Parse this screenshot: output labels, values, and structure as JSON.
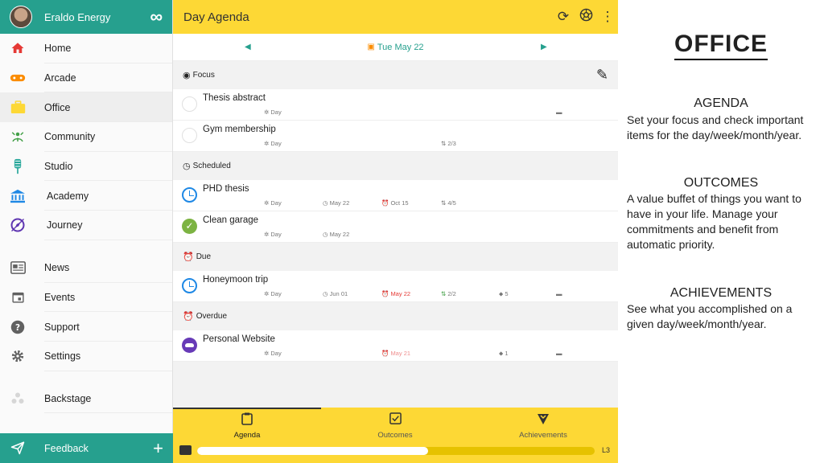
{
  "sidebar": {
    "app_title": "Eraldo Energy",
    "items": [
      {
        "label": "Home",
        "icon": "home-icon",
        "color": "#e53935"
      },
      {
        "label": "Arcade",
        "icon": "gamepad-icon",
        "color": "#fb8c00"
      },
      {
        "label": "Office",
        "icon": "briefcase-icon",
        "color": "#fdd835"
      },
      {
        "label": "Community",
        "icon": "community-icon",
        "color": "#43a047"
      },
      {
        "label": "Studio",
        "icon": "microphone-icon",
        "color": "#26a69a"
      },
      {
        "label": "Academy",
        "icon": "academy-icon",
        "color": "#1e88e5"
      },
      {
        "label": "Journey",
        "icon": "compass-icon",
        "color": "#5e35b1"
      },
      {
        "label": "News",
        "icon": "newspaper-icon",
        "color": "#616161"
      },
      {
        "label": "Events",
        "icon": "calendar-icon",
        "color": "#616161"
      },
      {
        "label": "Support",
        "icon": "help-icon",
        "color": "#616161"
      },
      {
        "label": "Settings",
        "icon": "gear-icon",
        "color": "#616161"
      },
      {
        "label": "Backstage",
        "icon": "backstage-icon",
        "color": "#bdbdbd"
      }
    ],
    "feedback_label": "Feedback"
  },
  "topbar": {
    "title": "Day Agenda"
  },
  "datebar": {
    "date": "Tue May 22"
  },
  "sections": [
    {
      "title": "Focus",
      "tasks": [
        {
          "name": "Thesis abstract",
          "status": "open",
          "meta": {
            "scope": "Day"
          }
        },
        {
          "name": "Gym membership",
          "status": "open",
          "meta": {
            "scope": "Day",
            "steps": "2/3"
          }
        }
      ]
    },
    {
      "title": "Scheduled",
      "tasks": [
        {
          "name": "PHD thesis",
          "status": "scheduled",
          "meta": {
            "scope": "Day",
            "date": "May 22",
            "deadline": "Oct 15",
            "steps": "4/5"
          }
        },
        {
          "name": "Clean garage",
          "status": "done",
          "meta": {
            "scope": "Day",
            "date": "May 22"
          }
        }
      ]
    },
    {
      "title": "Due",
      "tasks": [
        {
          "name": "Honeymoon trip",
          "status": "scheduled",
          "meta": {
            "scope": "Day",
            "date": "Jun 01",
            "deadline": "May 22",
            "steps": "2/2",
            "tags": "5"
          }
        }
      ]
    },
    {
      "title": "Overdue",
      "tasks": [
        {
          "name": "Personal Website",
          "status": "cloud",
          "meta": {
            "scope": "Day",
            "deadline": "May 21",
            "tags": "1"
          }
        }
      ]
    }
  ],
  "bottom_nav": {
    "tabs": [
      "Agenda",
      "Outcomes",
      "Achievements"
    ],
    "active": "Agenda",
    "progress": 0.58,
    "level": "L3"
  },
  "panel": {
    "title": "OFFICE",
    "agenda_head": "AGENDA",
    "agenda_text": "Set your focus and check important items for the day/week/month/year.",
    "outcomes_head": "OUTCOMES",
    "outcomes_text": "A value buffet of things you want to have in your life. Manage your commitments and benefit from automatic priority.",
    "achievements_head": "ACHIEVEMENTS",
    "achievements_text": "See what you accomplished on a given day/week/month/year."
  }
}
